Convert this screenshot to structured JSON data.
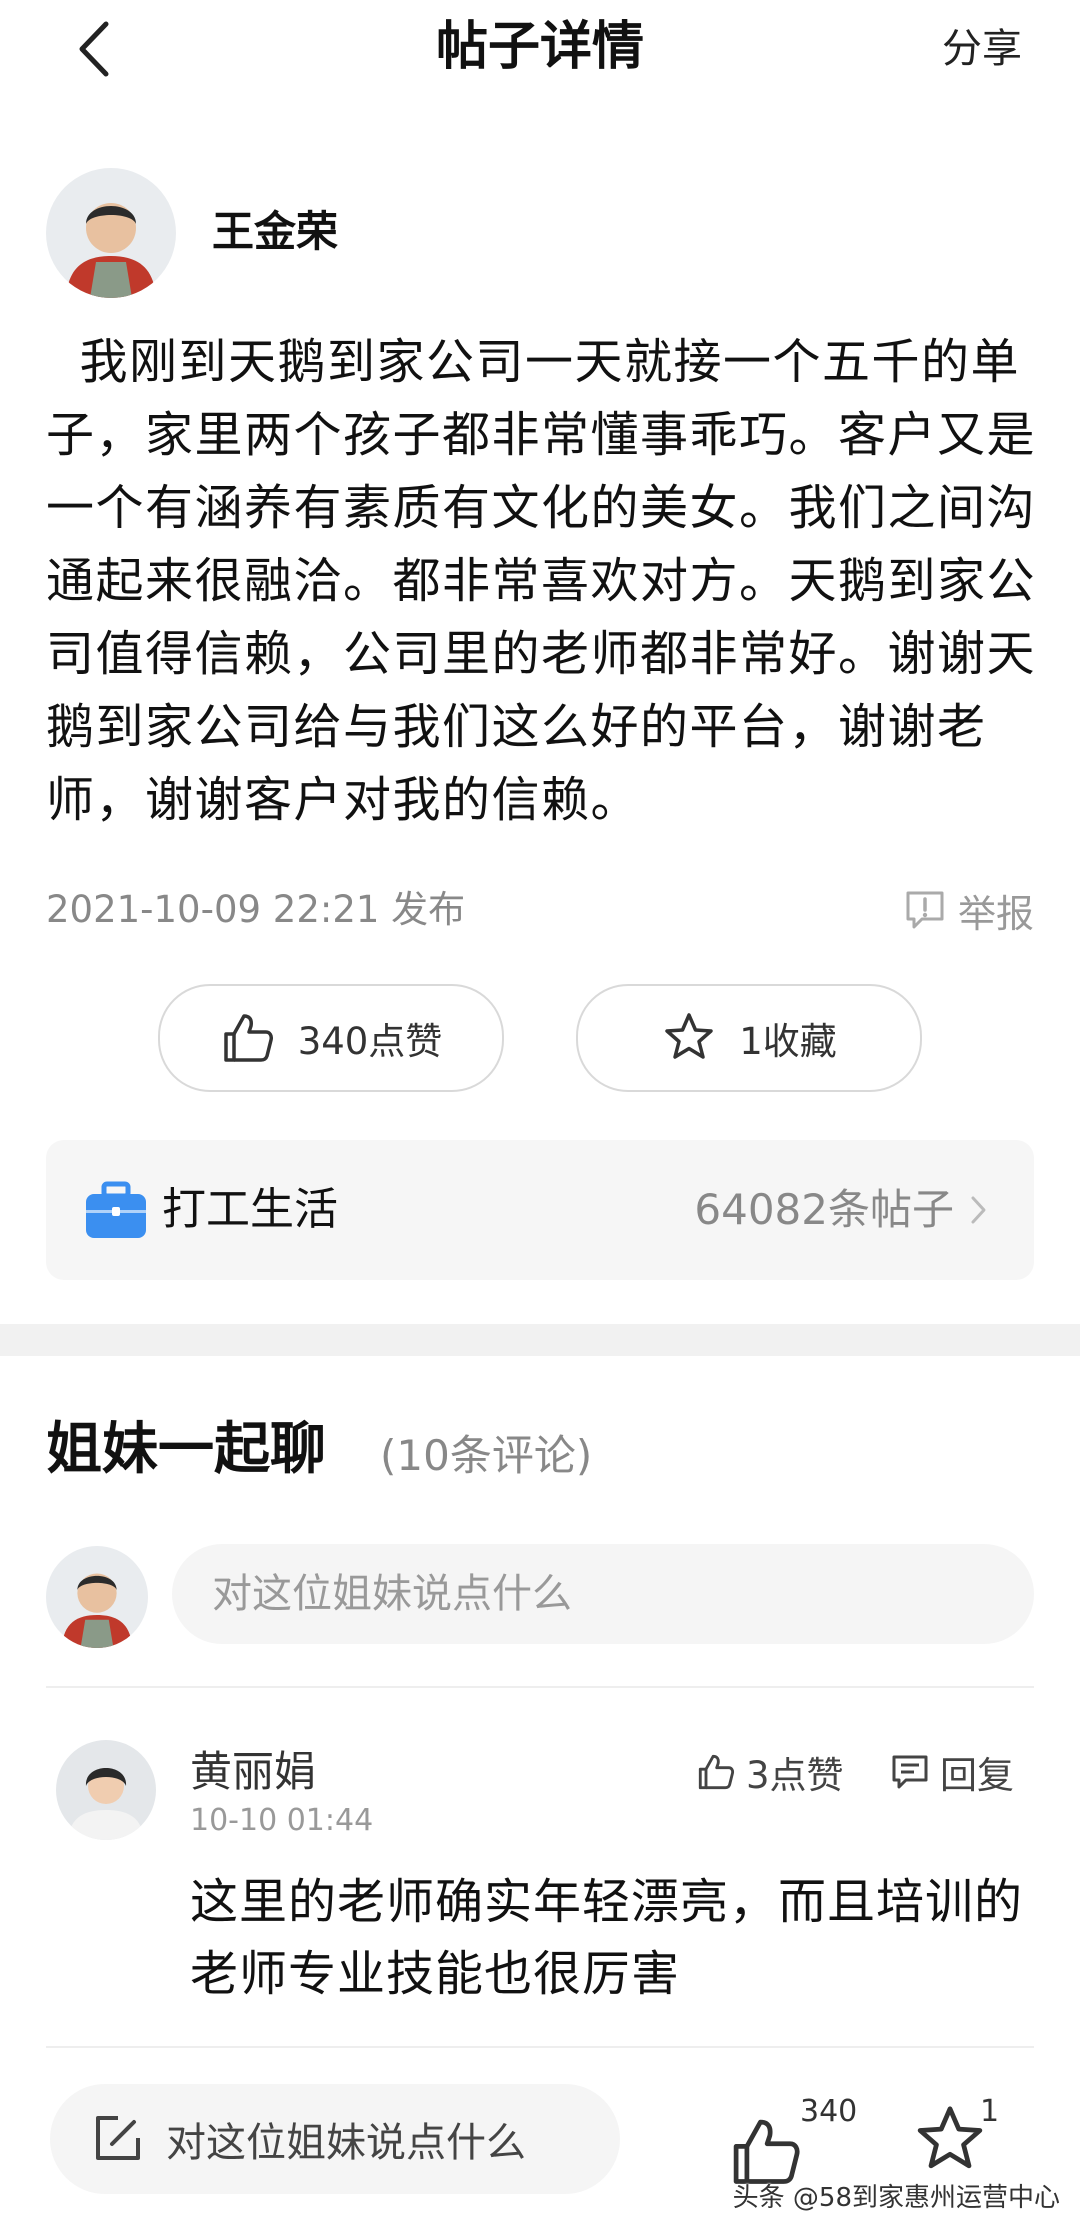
{
  "header": {
    "title": "帖子详情",
    "share_label": "分享"
  },
  "author": {
    "name": "王金荣"
  },
  "post": {
    "body": "  我刚到天鹅到家公司一天就接一个五千的单子，家里两个孩子都非常懂事乖巧。客户又是一个有涵养有素质有文化的美女。我们之间沟通起来很融洽。都非常喜欢对方。天鹅到家公司值得信赖，公司里的老师都非常好。谢谢天鹅到家公司给与我们这么好的平台，谢谢老师，谢谢客户对我的信赖。",
    "meta": "2021-10-09 22:21 发布",
    "report_label": "举报",
    "like_label": "340点赞",
    "favorite_label": "1收藏"
  },
  "topic": {
    "name": "打工生活",
    "count": "64082条帖子"
  },
  "comments_section": {
    "title": "姐妹一起聊",
    "count": "(10条评论)",
    "input_placeholder": "对这位姐妹说点什么"
  },
  "comments": [
    {
      "name": "黄丽娟",
      "time": "10-10 01:44",
      "likes": "3点赞",
      "reply_label": "回复",
      "text": "这里的老师确实年轻漂亮，而且培训的老师专业技能也很厉害"
    }
  ],
  "bottom_bar": {
    "input_label": "对这位姐妹说点什么",
    "like_count": "340",
    "favorite_count": "1"
  },
  "watermark": "头条 @58到家惠州运营中心",
  "colors": {
    "topic_icon": "#3b8ff0",
    "muted_text": "#888888",
    "border": "#d9d9d9"
  }
}
